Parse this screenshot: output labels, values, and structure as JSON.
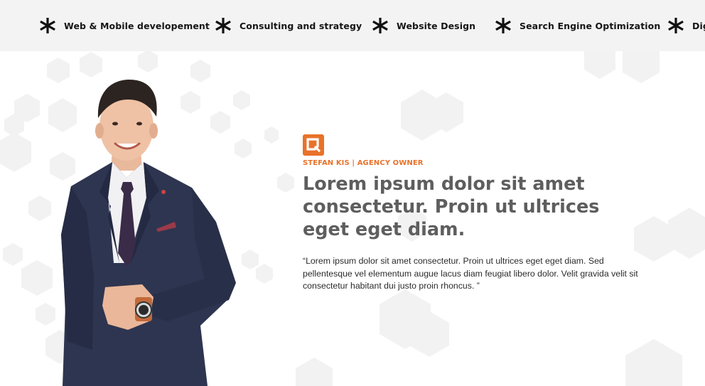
{
  "services_strip": {
    "items": [
      {
        "label": "Web & Mobile developement",
        "icon": "asterisk-icon"
      },
      {
        "label": "Consulting and strategy",
        "icon": "asterisk-icon"
      },
      {
        "label": "Website Design",
        "icon": "asterisk-icon"
      },
      {
        "label": "Search Engine Optimization",
        "icon": "asterisk-icon"
      },
      {
        "label": "Dig",
        "icon": "asterisk-icon"
      }
    ]
  },
  "hero": {
    "logo_icon": "brand-logo-icon",
    "eyebrow": "STEFAN KIS | AGENCY OWNER",
    "headline": "Lorem ipsum dolor sit amet consectetur. Proin ut ultrices eget eget diam.",
    "quote": "“Lorem ipsum dolor sit amet consectetur. Proin ut ultrices eget eget diam. Sed pellentesque vel elementum augue lacus diam feugiat libero dolor. Velit gravida velit sit consectetur habitant dui justo proin rhoncus. ”"
  },
  "colors": {
    "accent": "#e8722a",
    "headline": "#5e5e5e",
    "strip_bg": "#f3f3f3",
    "suit": "#2e3550"
  }
}
